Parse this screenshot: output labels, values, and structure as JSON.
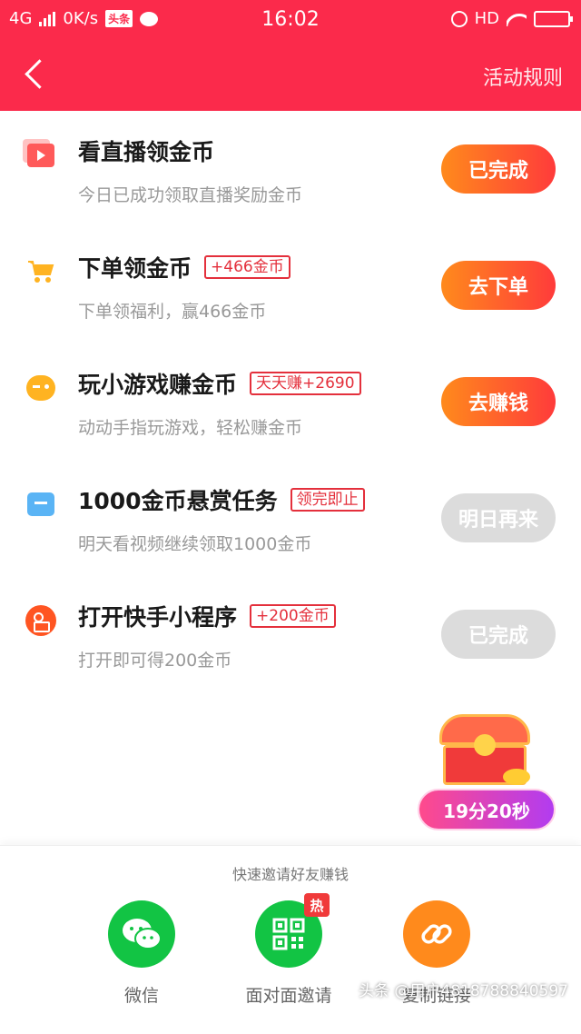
{
  "status_bar": {
    "network": "4G",
    "speed": "0K/s",
    "app_badge": "头条",
    "time": "16:02",
    "hd": "HD"
  },
  "header": {
    "rules": "活动规则"
  },
  "tasks": [
    {
      "title": "看直播领金币",
      "tag": "",
      "desc": "今日已成功领取直播奖励金币",
      "button": "已完成",
      "icon": "live-icon",
      "state": "active"
    },
    {
      "title": "下单领金币",
      "tag": "+466金币",
      "desc": "下单领福利，赢466金币",
      "button": "去下单",
      "icon": "cart-icon",
      "state": "active"
    },
    {
      "title": "玩小游戏赚金币",
      "tag": "天天赚+2690",
      "desc": "动动手指玩游戏，轻松赚金币",
      "button": "去赚钱",
      "icon": "game-icon",
      "state": "active"
    },
    {
      "title": "1000金币悬赏任务",
      "tag": "领完即止",
      "desc": "明天看视频继续领取1000金币",
      "button": "明日再来",
      "icon": "tv-icon",
      "state": "disabled"
    },
    {
      "title": "打开快手小程序",
      "tag": "+200金币",
      "desc": "打开即可得200金币",
      "button": "已完成",
      "icon": "kuaishou-icon",
      "state": "disabled"
    }
  ],
  "chest": {
    "timer": "19分20秒"
  },
  "invite": {
    "title": "快速邀请好友赚钱",
    "options": [
      {
        "label": "微信",
        "icon": "wechat-icon"
      },
      {
        "label": "面对面邀请",
        "icon": "qrcode-icon",
        "badge": "热"
      },
      {
        "label": "复制链接",
        "icon": "link-icon"
      }
    ]
  },
  "watermark": "头条 @用户4818788840597",
  "colors": {
    "header_red": "#fb2a4b",
    "button_orange": "#ff8a1c",
    "button_red": "#ff3b3b",
    "disabled_gray": "#dcdcdc",
    "tag_red": "#e4303c",
    "wechat_green": "#12c444"
  }
}
